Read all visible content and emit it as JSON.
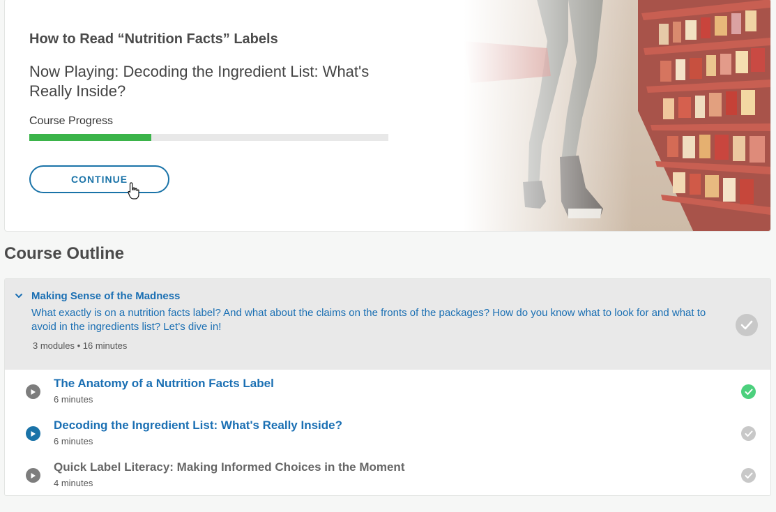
{
  "hero": {
    "course_title": "How to Read “Nutrition Facts” Labels",
    "now_playing": "Now Playing: Decoding the Ingredient List: What's Really Inside?",
    "progress_label": "Course Progress",
    "progress_percent": 34,
    "continue_label": "CONTINUE",
    "photo_icon": "grocery-aisle-photo"
  },
  "outline": {
    "heading": "Course Outline",
    "section": {
      "title": "Making Sense of the Madness",
      "description": "What exactly is on a nutrition facts label? And what about the claims on the fronts of the packages? How do you know what to look for and what to avoid in the ingredients list? Let’s dive in!",
      "meta": "3 modules • 16 minutes",
      "completed": false
    },
    "lessons": [
      {
        "title": "The Anatomy of a Nutrition Facts Label",
        "duration": "6 minutes",
        "status": "completed",
        "title_color": "#1a6fb3"
      },
      {
        "title": "Decoding the Ingredient List: What's Really Inside?",
        "duration": "6 minutes",
        "status": "current",
        "title_color": "#1a6fb3"
      },
      {
        "title": "Quick Label Literacy: Making Informed Choices in the Moment",
        "duration": "4 minutes",
        "status": "not-started",
        "title_color": "#666666"
      }
    ]
  },
  "colors": {
    "accent_blue": "#1a73a8",
    "progress_green": "#3bb44a",
    "check_green": "#4cd07d",
    "check_gray": "#c8c8c8"
  }
}
